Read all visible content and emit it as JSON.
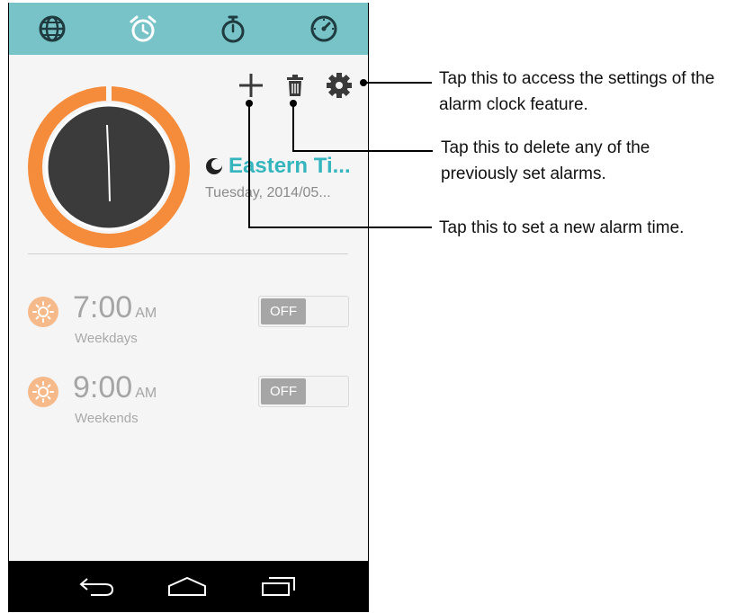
{
  "tabs": [
    {
      "name": "world-clock",
      "icon": "globe-icon"
    },
    {
      "name": "alarm",
      "icon": "alarm-clock-icon"
    },
    {
      "name": "stopwatch",
      "icon": "stopwatch-icon"
    },
    {
      "name": "timer",
      "icon": "timer-icon"
    }
  ],
  "toolbar": {
    "add_icon": "plus-icon",
    "delete_icon": "trash-icon",
    "settings_icon": "gear-icon"
  },
  "clock": {
    "timezone_icon": "moon-icon",
    "timezone": "Eastern Ti...",
    "date": "Tuesday, 2014/05..."
  },
  "alarms": [
    {
      "time": "7:00",
      "ampm": "AM",
      "days": "Weekdays",
      "toggle": "OFF",
      "icon": "sun-icon"
    },
    {
      "time": "9:00",
      "ampm": "AM",
      "days": "Weekends",
      "toggle": "OFF",
      "icon": "sun-icon"
    }
  ],
  "navbar": {
    "back_icon": "back-icon",
    "home_icon": "home-icon",
    "recents_icon": "recents-icon"
  },
  "callouts": {
    "settings": "Tap this to access the settings of the alarm clock feature.",
    "settings_l1": "Tap this to access the settings of the",
    "settings_l2": "alarm clock feature.",
    "delete_l1": "Tap this to delete any of the",
    "delete_l2": "previously set alarms.",
    "add": "Tap this to set a new alarm time."
  },
  "colors": {
    "tabbar": "#77c3c7",
    "accent_orange": "#f58c3c",
    "timezone_text": "#35b5bd",
    "navbar": "#000000"
  }
}
